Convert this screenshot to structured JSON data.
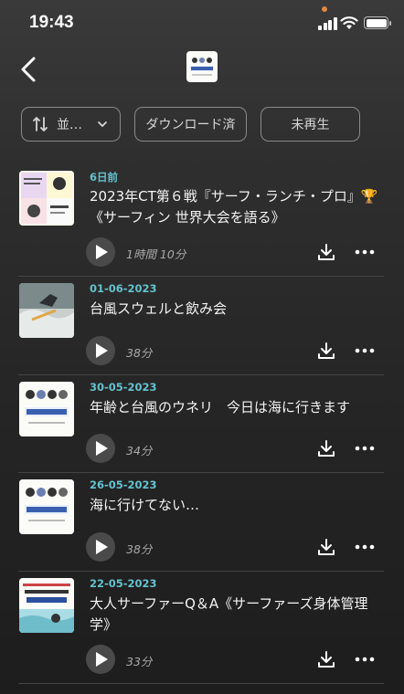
{
  "status_bar": {
    "time": "19:43",
    "indicator_color": "#e08a3c"
  },
  "nav": {
    "back_icon": "chevron-left-icon",
    "artwork": "podcast-artwork"
  },
  "filters": {
    "sort_label": "並…",
    "downloaded_label": "ダウンロード済",
    "unplayed_label": "未再生"
  },
  "colors": {
    "accent": "#64c2cf"
  },
  "episodes": [
    {
      "date": "6日前",
      "title": "2023年CT第６戦『サーフ・ランチ・プロ』🏆《サーフィン 世界大会を語る》",
      "duration": "1時間 10分"
    },
    {
      "date": "01-06-2023",
      "title": "台風スウェルと飲み会",
      "duration": "38分"
    },
    {
      "date": "30-05-2023",
      "title": "年齢と台風のウネリ　今日は海に行きます",
      "duration": "34分"
    },
    {
      "date": "26-05-2023",
      "title": "海に行けてない…",
      "duration": "38分"
    },
    {
      "date": "22-05-2023",
      "title": "大人サーファーQ＆A《サーファーズ身体管理学》",
      "duration": "33分"
    }
  ]
}
